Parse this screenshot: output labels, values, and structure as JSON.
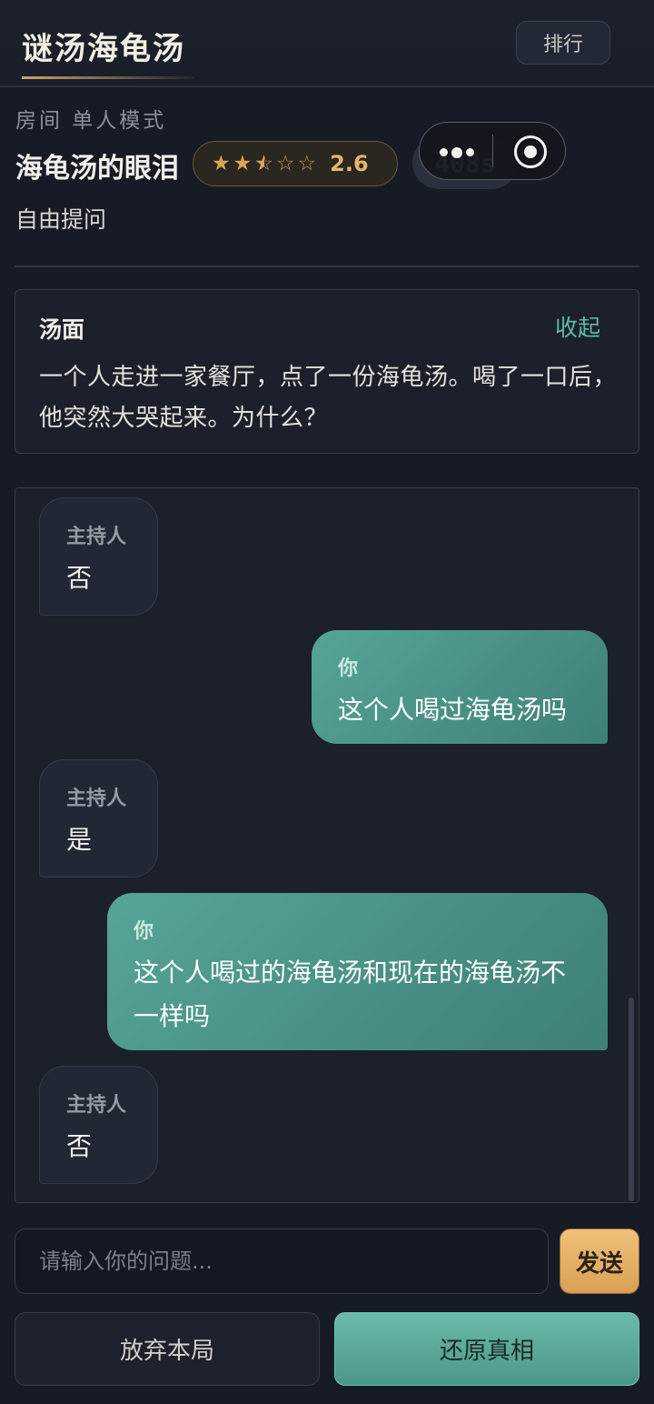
{
  "header": {
    "app_title": "谜汤海龟汤",
    "rank_label": "排行"
  },
  "room": {
    "label": "房间 单人模式",
    "puzzle_name": "海龟汤的眼泪",
    "rating_value": "2.6",
    "rating_stars": 2.5,
    "rating_max": 5,
    "timer": "408s",
    "mode": "自由提问"
  },
  "soup": {
    "title": "汤面",
    "collapse_label": "收起",
    "text": "一个人走进一家餐厅，点了一份海龟汤。喝了一口后，他突然大哭起来。为什么？"
  },
  "chat": {
    "messages": [
      {
        "role": "host",
        "sender": "主持人",
        "text": "否"
      },
      {
        "role": "user",
        "sender": "你",
        "text": "这个人喝过海龟汤吗"
      },
      {
        "role": "host",
        "sender": "主持人",
        "text": "是"
      },
      {
        "role": "user",
        "sender": "你",
        "text": "这个人喝过的海龟汤和现在的海龟汤不一样吗"
      },
      {
        "role": "host",
        "sender": "主持人",
        "text": "否"
      }
    ]
  },
  "input": {
    "placeholder": "请输入你的问题...",
    "value": "",
    "send_label": "发送"
  },
  "actions": {
    "give_up_label": "放弃本局",
    "reveal_label": "还原真相"
  },
  "colors": {
    "accent_teal": "#55a596",
    "accent_gold": "#e5b56a",
    "background": "#171b26"
  },
  "icons": {
    "capsule_more": "more-dots-icon",
    "capsule_close": "mini-program-close-icon",
    "star": "star-icon"
  }
}
